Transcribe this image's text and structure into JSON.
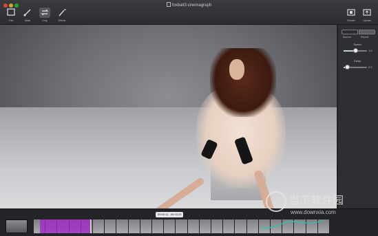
{
  "window": {
    "title": "foxbait3.cinemagraph"
  },
  "toolbar": {
    "tools": [
      {
        "label": "Trim",
        "icon": "crop-icon",
        "active": false
      },
      {
        "label": "Mask",
        "icon": "brush-icon",
        "active": false
      },
      {
        "label": "Loop",
        "icon": "loop-icon",
        "active": true
      },
      {
        "label": "Effects",
        "icon": "magic-wand-icon",
        "active": false
      }
    ],
    "right_buttons": [
      {
        "label": "Render",
        "icon": "render-icon"
      },
      {
        "label": "Upload",
        "icon": "upload-icon"
      }
    ]
  },
  "loop_panel": {
    "modes": [
      {
        "label": "Bounce",
        "selected": false
      },
      {
        "label": "Repeat",
        "selected": true
      }
    ],
    "speed": {
      "label": "Speed",
      "value_text": "1.0",
      "fraction": 0.5
    },
    "delay": {
      "label": "Delay",
      "value_text": "0.2",
      "fraction": 0.15
    }
  },
  "timeline": {
    "timecode": "00:00:11 - 00:03:23",
    "selection_start_fraction": 0.02,
    "selection_end_fraction": 0.19
  },
  "watermark": {
    "text_cn": "当下软件园",
    "url": "www.downxia.com"
  },
  "colors": {
    "selection": "#a028c8",
    "accent_curve": "#22c8b0"
  }
}
